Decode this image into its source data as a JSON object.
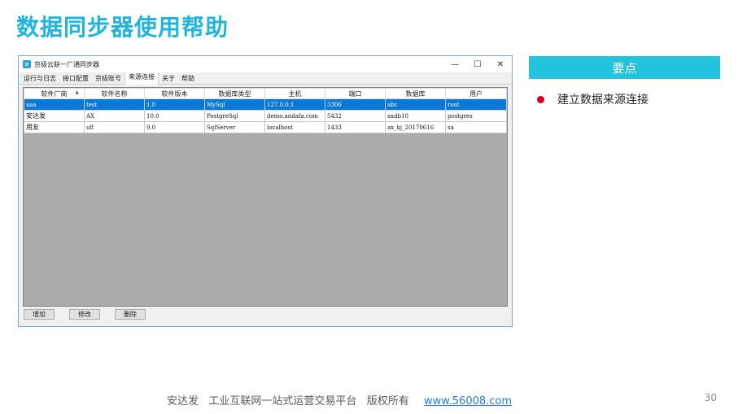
{
  "slide": {
    "title": "数据同步器使用帮助"
  },
  "window": {
    "title": "京极云联一厂通同步器",
    "controls": {
      "minimize": "—",
      "maximize": "☐",
      "close": "✕"
    },
    "tabs": [
      "运行与日志",
      "接口配置",
      "京极账号",
      "来源连接",
      "关于",
      "帮助"
    ],
    "active_tab": "来源连接"
  },
  "table": {
    "headers": [
      "软件厂商",
      "软件名称",
      "软件版本",
      "数据库类型",
      "主机",
      "端口",
      "数据库",
      "用户"
    ],
    "sort_indicator": "▲",
    "rows": [
      [
        "aaa",
        "test",
        "1.0",
        "MySql",
        "127.0.0.1",
        "3306",
        "abc",
        "root"
      ],
      [
        "安达发",
        "AX",
        "10.0",
        "PostgreSql",
        "demo.andafa.com",
        "5432",
        "axdb10",
        "postgres"
      ],
      [
        "用友",
        "u8",
        "9.0",
        "SqlServer",
        "localhost",
        "1433",
        "ax_kj_20170616",
        "sa"
      ]
    ],
    "selected_row": 0
  },
  "buttons": {
    "add": "增加",
    "edit": "修改",
    "delete": "删除"
  },
  "keypoints": {
    "header": "要点",
    "items": [
      "建立数据来源连接"
    ],
    "bullet_color": "#d0021b"
  },
  "footer": {
    "text": "安达发   工业互联网一站式运营交易平台   版权所有",
    "link": "www.56008.com",
    "page_number": "30"
  },
  "colors": {
    "title": "#1fb5dd",
    "header_bar": "#22c3de",
    "selection": "#0a78d7"
  }
}
